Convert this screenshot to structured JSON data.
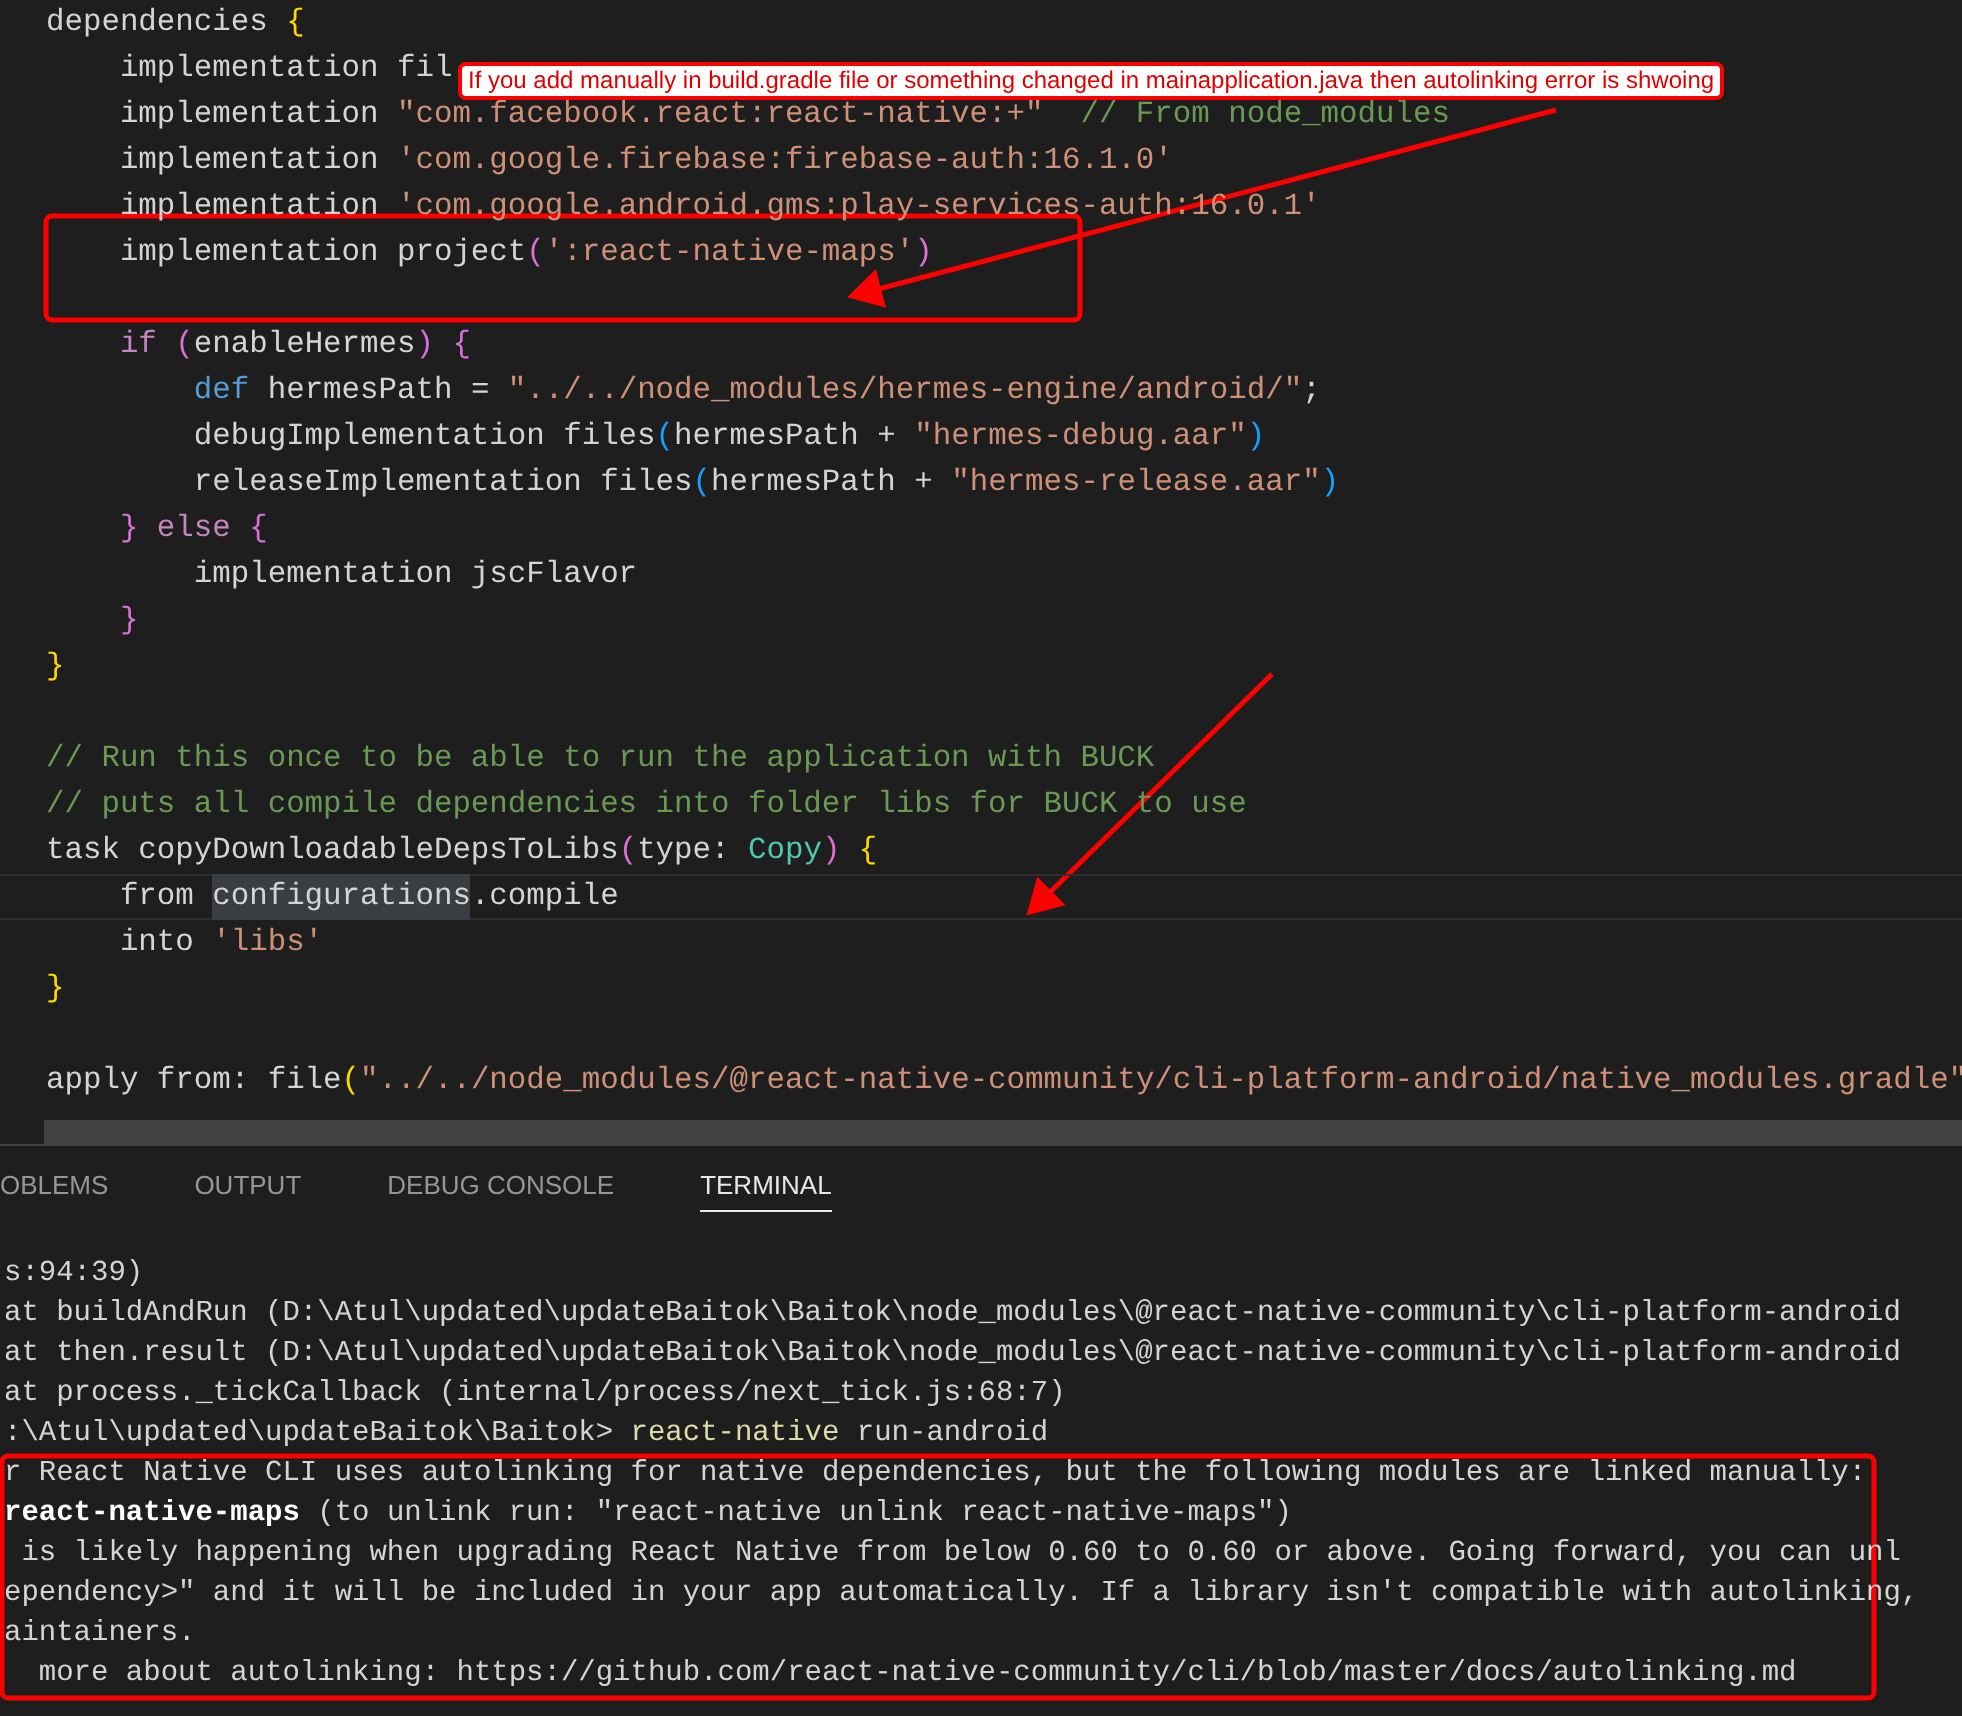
{
  "editor": {
    "lines": [
      {
        "highlighted": false,
        "segments": [
          {
            "text": "dependencies ",
            "kind": "plain"
          },
          {
            "text": "{",
            "kind": "bracket1"
          }
        ]
      },
      {
        "highlighted": false,
        "segments": [
          {
            "text": "    implementation fil",
            "kind": "plain"
          }
        ]
      },
      {
        "highlighted": false,
        "segments": [
          {
            "text": "    implementation ",
            "kind": "plain"
          },
          {
            "text": "\"com.facebook.react:react-native:+\"",
            "kind": "string"
          },
          {
            "text": "  // From node_modules",
            "kind": "comment"
          }
        ]
      },
      {
        "highlighted": false,
        "segments": [
          {
            "text": "    implementation ",
            "kind": "plain"
          },
          {
            "text": "'com.google.firebase:firebase-auth:16.1.0'",
            "kind": "string"
          }
        ]
      },
      {
        "highlighted": false,
        "segments": [
          {
            "text": "    implementation ",
            "kind": "plain"
          },
          {
            "text": "'com.google.android.gms:play-services-auth:16.0.1'",
            "kind": "string"
          }
        ]
      },
      {
        "highlighted": false,
        "segments": [
          {
            "text": "    implementation project",
            "kind": "plain"
          },
          {
            "text": "(",
            "kind": "bracket2"
          },
          {
            "text": "':react-native-maps'",
            "kind": "string"
          },
          {
            "text": ")",
            "kind": "bracket2"
          }
        ]
      },
      {
        "highlighted": false
      },
      {
        "highlighted": false,
        "segments": [
          {
            "text": "    if ",
            "kind": "control"
          },
          {
            "text": "(",
            "kind": "bracket2"
          },
          {
            "text": "enableHermes",
            "kind": "plain"
          },
          {
            "text": ")",
            "kind": "bracket2"
          },
          {
            "text": " {",
            "kind": "bracket2"
          }
        ]
      },
      {
        "highlighted": false,
        "segments": [
          {
            "text": "        def",
            "kind": "keyword"
          },
          {
            "text": " hermesPath = ",
            "kind": "plain"
          },
          {
            "text": "\"../../node_modules/hermes-engine/android/\"",
            "kind": "string"
          },
          {
            "text": ";",
            "kind": "plain"
          }
        ]
      },
      {
        "highlighted": false,
        "segments": [
          {
            "text": "        debugImplementation files",
            "kind": "plain"
          },
          {
            "text": "(",
            "kind": "bracket3"
          },
          {
            "text": "hermesPath + ",
            "kind": "plain"
          },
          {
            "text": "\"hermes-debug.aar\"",
            "kind": "string"
          },
          {
            "text": ")",
            "kind": "bracket3"
          }
        ]
      },
      {
        "highlighted": false,
        "segments": [
          {
            "text": "        releaseImplementation files",
            "kind": "plain"
          },
          {
            "text": "(",
            "kind": "bracket3"
          },
          {
            "text": "hermesPath + ",
            "kind": "plain"
          },
          {
            "text": "\"hermes-release.aar\"",
            "kind": "string"
          },
          {
            "text": ")",
            "kind": "bracket3"
          }
        ]
      },
      {
        "highlighted": false,
        "segments": [
          {
            "text": "    } ",
            "kind": "bracket2"
          },
          {
            "text": "else ",
            "kind": "control"
          },
          {
            "text": "{",
            "kind": "bracket2"
          }
        ]
      },
      {
        "highlighted": false,
        "segments": [
          {
            "text": "        implementation jscFlavor",
            "kind": "plain"
          }
        ]
      },
      {
        "highlighted": false,
        "segments": [
          {
            "text": "    }",
            "kind": "bracket2"
          }
        ]
      },
      {
        "highlighted": false,
        "segments": [
          {
            "text": "}",
            "kind": "bracket1"
          }
        ]
      },
      {
        "highlighted": false
      },
      {
        "highlighted": false,
        "segments": [
          {
            "text": "// Run this once to be able to run the application with BUCK",
            "kind": "comment"
          }
        ]
      },
      {
        "highlighted": false,
        "segments": [
          {
            "text": "// puts all compile dependencies into folder libs for BUCK to use",
            "kind": "comment"
          }
        ]
      },
      {
        "highlighted": false,
        "segments": [
          {
            "text": "task copyDownloadableDepsToLibs",
            "kind": "plain"
          },
          {
            "text": "(",
            "kind": "bracket2"
          },
          {
            "text": "type: ",
            "kind": "plain"
          },
          {
            "text": "Copy",
            "kind": "type"
          },
          {
            "text": ")",
            "kind": "bracket2"
          },
          {
            "text": " {",
            "kind": "bracket1"
          }
        ]
      },
      {
        "highlighted": true,
        "segments": [
          {
            "text": "    from ",
            "kind": "plain"
          },
          {
            "text": "configurations",
            "kind": "match"
          },
          {
            "text": ".compile",
            "kind": "plain"
          }
        ]
      },
      {
        "highlighted": false,
        "segments": [
          {
            "text": "    into ",
            "kind": "plain"
          },
          {
            "text": "'libs'",
            "kind": "string"
          }
        ]
      },
      {
        "highlighted": false,
        "segments": [
          {
            "text": "}",
            "kind": "bracket1"
          }
        ]
      },
      {
        "highlighted": false
      },
      {
        "highlighted": false,
        "segments": [
          {
            "text": "apply from: file",
            "kind": "plain"
          },
          {
            "text": "(",
            "kind": "bracket1"
          },
          {
            "text": "\"../../node_modules/@react-native-community/cli-platform-android/native_modules.gradle\"",
            "kind": "string"
          }
        ]
      }
    ]
  },
  "panel": {
    "tabs": [
      {
        "label": "OBLEMS",
        "selected": false
      },
      {
        "label": "OUTPUT",
        "selected": false
      },
      {
        "label": "DEBUG CONSOLE",
        "selected": false
      },
      {
        "label": "TERMINAL",
        "selected": true
      }
    ]
  },
  "terminal": {
    "lines": [
      {
        "segments": [
          {
            "text": "s:94:39)",
            "kind": "plain"
          }
        ]
      },
      {
        "segments": [
          {
            "text": "at buildAndRun (D:\\Atul\\updated\\updateBaitok\\Baitok\\node_modules\\@react-native-community\\cli-platform-android",
            "kind": "plain"
          }
        ]
      },
      {
        "segments": [
          {
            "text": "at then.result (D:\\Atul\\updated\\updateBaitok\\Baitok\\node_modules\\@react-native-community\\cli-platform-android",
            "kind": "plain"
          }
        ]
      },
      {
        "segments": [
          {
            "text": "at process._tickCallback (internal/process/next_tick.js:68:7)",
            "kind": "plain"
          }
        ]
      },
      {
        "segments": [
          {
            "text": ":\\Atul\\updated\\updateBaitok\\Baitok> ",
            "kind": "plain"
          },
          {
            "text": "react-native",
            "kind": "command"
          },
          {
            "text": " run-android",
            "kind": "plain"
          }
        ]
      },
      {
        "segments": [
          {
            "text": "r React Native CLI uses autolinking for native dependencies, but the following modules are linked manually:",
            "kind": "plain"
          }
        ]
      },
      {
        "segments": [
          {
            "text": "react-native-maps",
            "kind": "bold"
          },
          {
            "text": " (to unlink run: \"react-native unlink react-native-maps\")",
            "kind": "plain"
          }
        ]
      },
      {
        "segments": [
          {
            "text": " is likely happening when upgrading React Native from below 0.60 to 0.60 or above. Going forward, you can unl",
            "kind": "plain"
          }
        ]
      },
      {
        "segments": [
          {
            "text": "ependency>\" and it will be included in your app automatically. If a library isn't compatible with autolinking,",
            "kind": "plain"
          }
        ]
      },
      {
        "segments": [
          {
            "text": "aintainers.",
            "kind": "plain"
          }
        ]
      },
      {
        "segments": [
          {
            "text": "  more about autolinking: https://github.com/react-native-community/cli/blob/master/docs/autolinking.md",
            "kind": "plain"
          }
        ]
      }
    ]
  },
  "annotation": {
    "callout": "If you add manually in build.gradle file or something changed in mainapplication.java then autolinking error is shwoing"
  }
}
